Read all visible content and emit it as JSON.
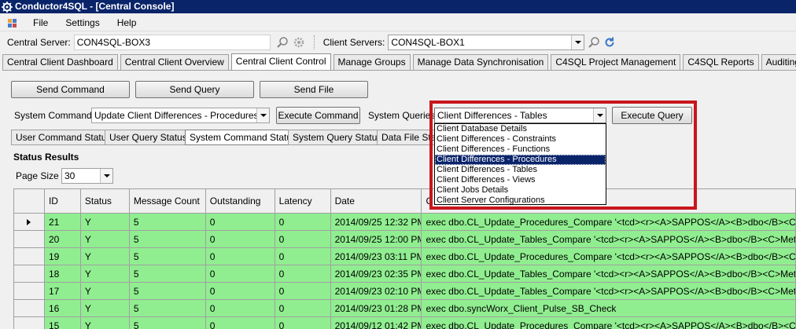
{
  "window": {
    "title": "Conductor4SQL - [Central Console]"
  },
  "menu": {
    "items": [
      "File",
      "Settings",
      "Help"
    ]
  },
  "servers": {
    "central_label": "Central Server:",
    "central_value": "CON4SQL-BOX3",
    "client_label": "Client Servers:",
    "client_value": "CON4SQL-BOX1"
  },
  "tabs": [
    "Central Client Dashboard",
    "Central Client Overview",
    "Central Client Control",
    "Manage Groups",
    "Manage Data Synchronisation",
    "C4SQL Project Management",
    "C4SQL Reports",
    "Auditing"
  ],
  "active_tab": "Central Client Control",
  "actions": {
    "send_command": "Send Command",
    "send_query": "Send Query",
    "send_file": "Send File",
    "execute_command": "Execute Command",
    "execute_query": "Execute Query"
  },
  "system_commands": {
    "label": "System Commands",
    "value": "Update Client Differences - Procedures"
  },
  "system_queries": {
    "label": "System Queries",
    "value": "Client Differences - Tables",
    "options": [
      "Client Database Details",
      "Client Differences - Constraints",
      "Client Differences - Functions",
      "Client Differences - Procedures",
      "Client Differences - Tables",
      "Client Differences - Views",
      "Client Jobs Details",
      "Client Server Configurations"
    ],
    "highlighted": "Client Differences - Procedures"
  },
  "status_tabs": [
    "User Command Status",
    "User Query Status",
    "System Command Status",
    "System Query Status",
    "Data File Sta"
  ],
  "active_status_tab": "System Command Status",
  "status_results": {
    "heading": "Status Results",
    "page_size_label": "Page Size",
    "page_size": "30"
  },
  "grid": {
    "columns": [
      "ID",
      "Status",
      "Message Count",
      "Outstanding",
      "Latency",
      "Date",
      "C"
    ],
    "rows": [
      {
        "id": "21",
        "status": "Y",
        "msg": "5",
        "out": "0",
        "lat": "0",
        "date": "2014/09/25 12:32 PM",
        "cmd": "exec dbo.CL_Update_Procedures_Compare '<tcd><r><A>SAPPOS</A><B>dbo</B><C>syncWorx_",
        "current": true
      },
      {
        "id": "20",
        "status": "Y",
        "msg": "5",
        "out": "0",
        "lat": "0",
        "date": "2014/09/25 12:00 PM",
        "cmd": "exec dbo.CL_Update_Tables_Compare '<tcd><r><A>SAPPOS</A><B>dbo</B><C>MetaTest</C></"
      },
      {
        "id": "19",
        "status": "Y",
        "msg": "5",
        "out": "0",
        "lat": "0",
        "date": "2014/09/23 03:11 PM",
        "cmd": "exec dbo.CL_Update_Procedures_Compare '<tcd><r><A>SAPPOS</A><B>dbo</B><C>syncWorx_"
      },
      {
        "id": "18",
        "status": "Y",
        "msg": "5",
        "out": "0",
        "lat": "0",
        "date": "2014/09/23 02:35 PM",
        "cmd": "exec dbo.CL_Update_Tables_Compare '<tcd><r><A>SAPPOS</A><B>dbo</B><C>MetaTest</C></"
      },
      {
        "id": "17",
        "status": "Y",
        "msg": "5",
        "out": "0",
        "lat": "0",
        "date": "2014/09/23 02:10 PM",
        "cmd": "exec dbo.CL_Update_Tables_Compare '<tcd><r><A>SAPPOS</A><B>dbo</B><C>MetaTest</C></"
      },
      {
        "id": "16",
        "status": "Y",
        "msg": "5",
        "out": "0",
        "lat": "0",
        "date": "2014/09/23 01:28 PM",
        "cmd": "exec dbo.syncWorx_Client_Pulse_SB_Check"
      },
      {
        "id": "15",
        "status": "Y",
        "msg": "5",
        "out": "0",
        "lat": "0",
        "date": "2014/09/12 01:42 PM",
        "cmd": "exec dbo.CL_Update_Procedures_Compare '<tcd><r><A>SAPPOS</A><B>dbo</B><C>syncWorx_"
      }
    ]
  },
  "colors": {
    "row_green": "#90ee90",
    "title_blue": "#0a246a",
    "highlight_red": "#c8161d"
  }
}
